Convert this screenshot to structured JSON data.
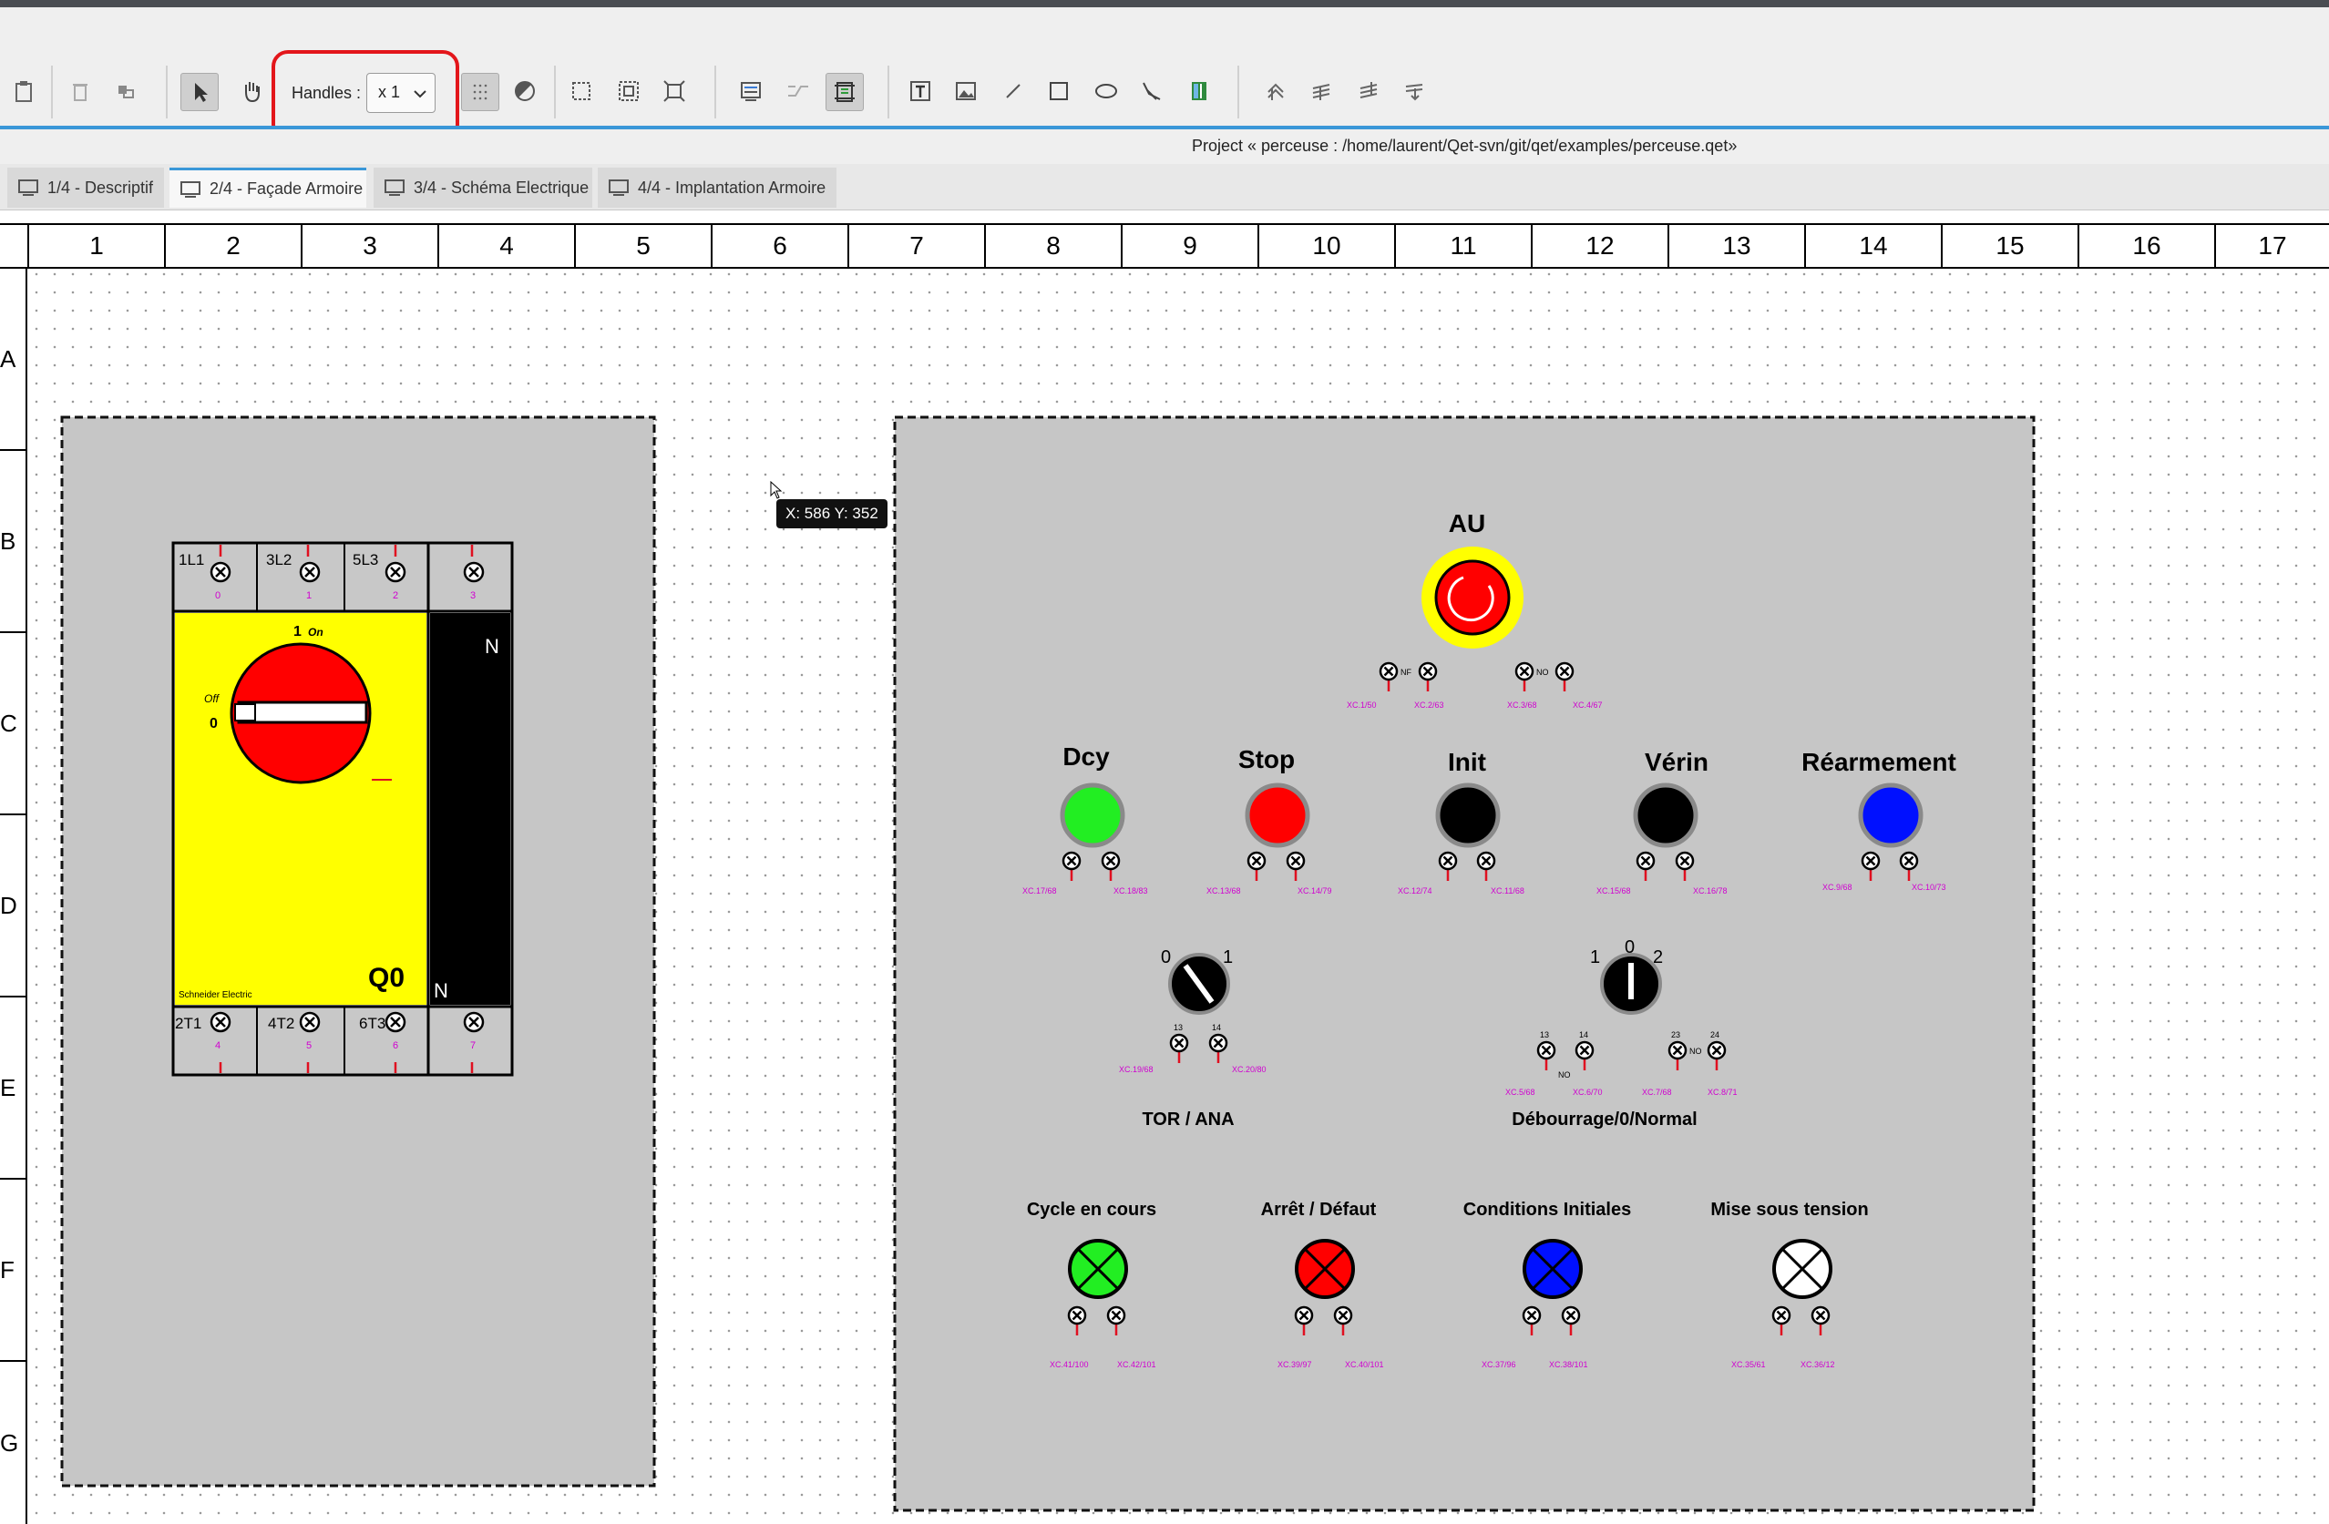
{
  "toolbar": {
    "handles_label": "Handles :",
    "handles_value": "x 1"
  },
  "project": {
    "title": "Project « perceuse : /home/laurent/Qet-svn/git/qet/examples/perceuse.qet»"
  },
  "tabs": [
    {
      "label": "1/4 - Descriptif",
      "active": false
    },
    {
      "label": "2/4 - Façade Armoire",
      "active": true
    },
    {
      "label": "3/4 - Schéma Electrique",
      "active": false
    },
    {
      "label": "4/4 - Implantation Armoire",
      "active": false
    }
  ],
  "columns": [
    "1",
    "2",
    "3",
    "4",
    "5",
    "6",
    "7",
    "8",
    "9",
    "10",
    "11",
    "12",
    "13",
    "14",
    "15",
    "16",
    "17"
  ],
  "rows": [
    "A",
    "B",
    "C",
    "D",
    "E",
    "F",
    "G"
  ],
  "cursor_tooltip": "X: 586 Y: 352",
  "switch_q0": {
    "top_terminals": [
      "1L1",
      "3L2",
      "5L3"
    ],
    "top_numbers": [
      "0",
      "1",
      "2",
      "3"
    ],
    "bottom_terminals": [
      "2T1",
      "4T2",
      "6T3"
    ],
    "bottom_numbers": [
      "4",
      "5",
      "6",
      "7"
    ],
    "neutral_top": "N",
    "neutral_bottom": "N",
    "on_digit": "1",
    "on_label": "On",
    "off_label": "Off",
    "off_digit": "0",
    "name": "Q0",
    "brand": "Schneider Electric"
  },
  "emergency_stop": {
    "label": "AU",
    "contact_nf": "NF",
    "contact_no": "NO",
    "refs": [
      "XC.1/50",
      "XC.2/63",
      "XC.3/68",
      "XC.4/67"
    ]
  },
  "pushbuttons": [
    {
      "label": "Dcy",
      "color": "#22ee22",
      "refs": [
        "XC.17/68",
        "XC.18/83"
      ]
    },
    {
      "label": "Stop",
      "color": "#ff0000",
      "refs": [
        "XC.13/68",
        "XC.14/79"
      ]
    },
    {
      "label": "Init",
      "color": "#000000",
      "refs": [
        "XC.12/74",
        "XC.11/68"
      ]
    },
    {
      "label": "Vérin",
      "color": "#000000",
      "refs": [
        "XC.15/68",
        "XC.16/78"
      ]
    },
    {
      "label": "Réarmement",
      "color": "#0010ff",
      "refs": [
        "XC.9/68",
        "XC.10/73"
      ]
    }
  ],
  "selector_tor": {
    "label": "TOR / ANA",
    "pos_left": "0",
    "pos_right": "1",
    "terms": [
      "13",
      "14"
    ],
    "refs": [
      "XC.19/68",
      "XC.20/80"
    ]
  },
  "selector_deb": {
    "label": "Débourrage/0/Normal",
    "pos_left": "1",
    "pos_mid": "0",
    "pos_right": "2",
    "terms1": [
      "13",
      "14"
    ],
    "terms2": [
      "23",
      "24"
    ],
    "no1": "NO",
    "no2": "NO",
    "refs": [
      "XC.5/68",
      "XC.6/70",
      "XC.7/68",
      "XC.8/71"
    ]
  },
  "lamps": [
    {
      "label": "Cycle en cours",
      "color": "#22ee22",
      "refs": [
        "XC.41/100",
        "XC.42/101"
      ]
    },
    {
      "label": "Arrêt / Défaut",
      "color": "#ff0000",
      "refs": [
        "XC.39/97",
        "XC.40/101"
      ]
    },
    {
      "label": "Conditions Initiales",
      "color": "#0010ff",
      "refs": [
        "XC.37/96",
        "XC.38/101"
      ]
    },
    {
      "label": "Mise sous tension",
      "color": "#ffffff",
      "refs": [
        "XC.35/61",
        "XC.36/12"
      ]
    }
  ]
}
